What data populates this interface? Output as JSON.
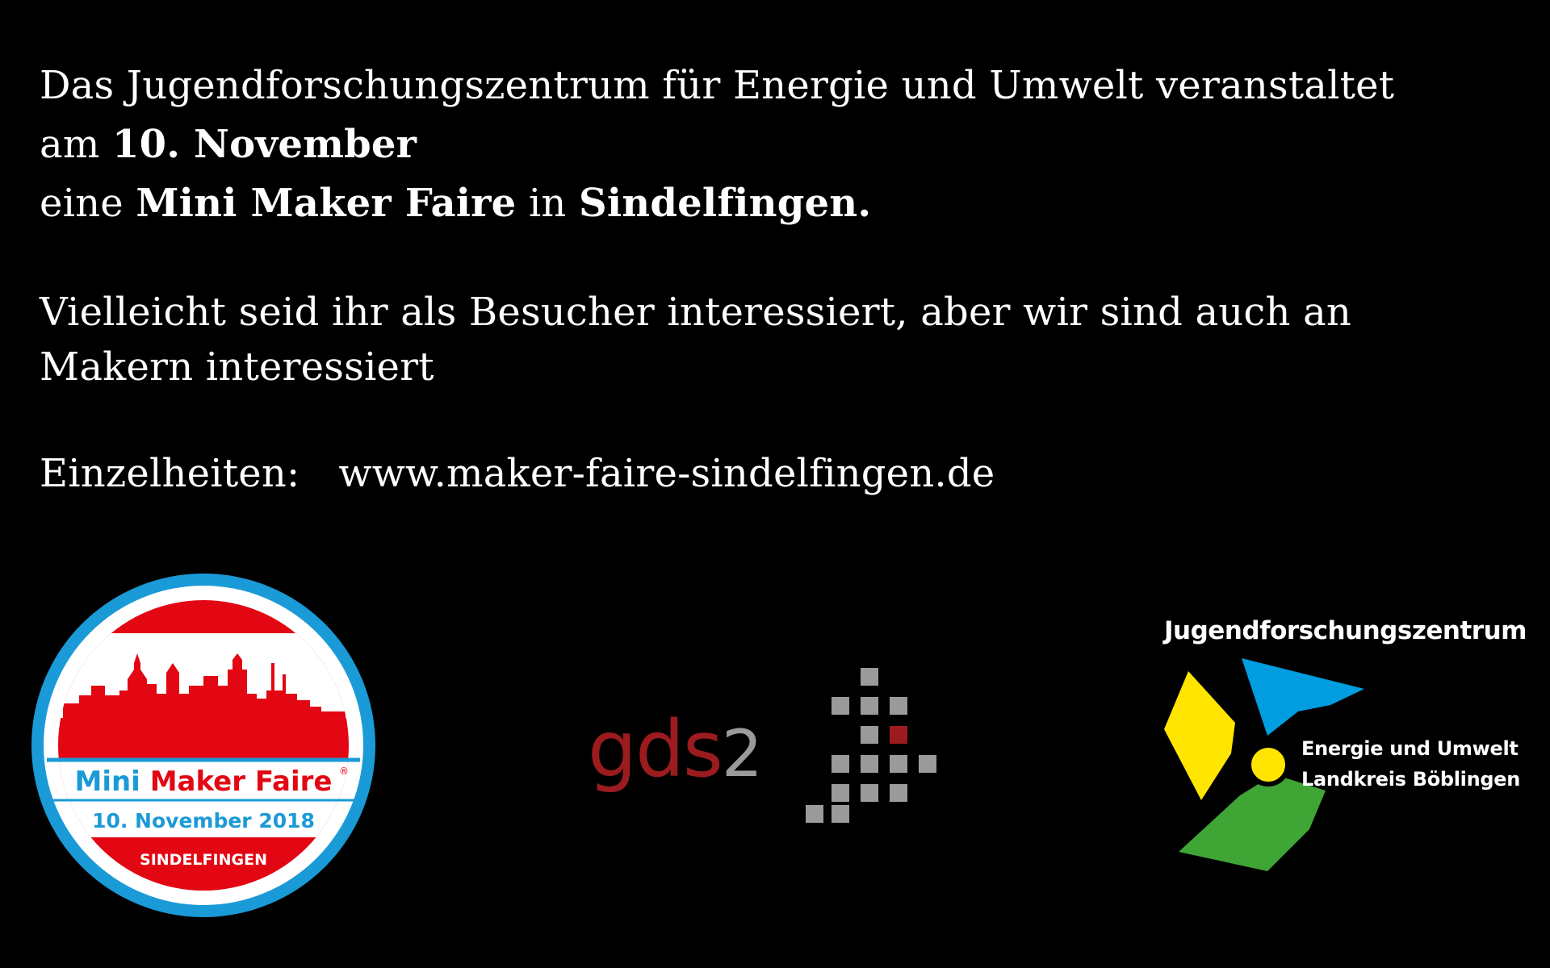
{
  "announcement": {
    "line1": "Das Jugendforschungszentrum für Energie und Umwelt veranstaltet",
    "line2_prefix": "am ",
    "line2_date": "10. November",
    "line3_prefix": "eine ",
    "line3_event": "Mini Maker Faire",
    "line3_mid": " in ",
    "line3_city": "Sindelfingen.",
    "para2_line1": "Vielleicht seid ihr als Besucher interessiert, aber wir sind auch an",
    "para2_line2": "Makern interessiert",
    "details_label": "Einzelheiten:",
    "details_url": "www.maker-faire-sindelfingen.de"
  },
  "badge": {
    "name_part1": "Mini",
    "name_part2": "Maker Faire",
    "registered": "®",
    "date": "10. November 2018",
    "city": "SINDELFINGEN",
    "colors": {
      "blue": "#1a9ad6",
      "red": "#e30613",
      "white": "#ffffff"
    }
  },
  "gds2_logo": {
    "text": "gds2",
    "colors": {
      "text_red": "#9b1b1f",
      "text_gray": "#9a9a9a",
      "square_gray": "#9a9a9a",
      "square_red": "#9b1b1f"
    }
  },
  "jfz_logo": {
    "title": "Jugendforschungszentrum",
    "line1": "Energie und Umwelt",
    "line2": "Landkreis Böblingen",
    "colors": {
      "yellow": "#ffe500",
      "blue": "#009de0",
      "green": "#3fa535",
      "center": "#ffe500"
    }
  }
}
